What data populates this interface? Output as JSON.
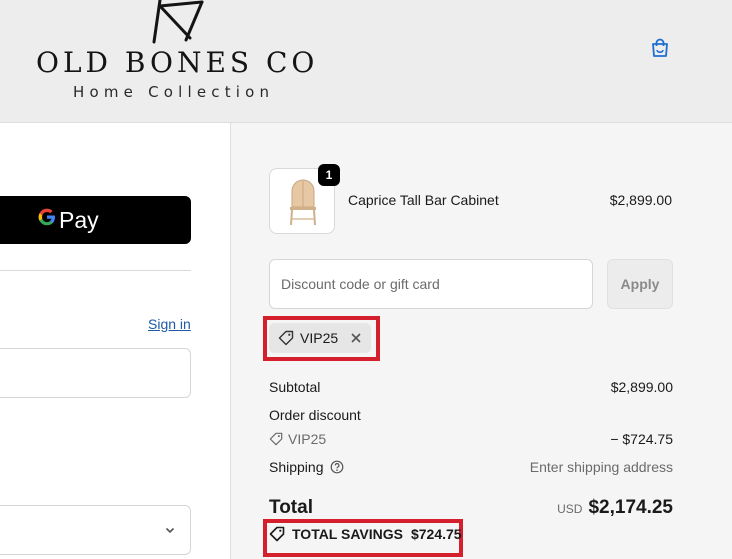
{
  "header": {
    "brand_name": "OLD BONES CO",
    "brand_sub": "Home Collection",
    "bag_icon": "shopping-bag-icon"
  },
  "left": {
    "gpay_label": "Pay",
    "gpay_glyph": "G",
    "signin_label": "Sign in",
    "email_value": "",
    "select_value": ""
  },
  "order": {
    "item": {
      "name": "Caprice Tall Bar Cabinet",
      "price": "$2,899.00",
      "quantity": "1"
    },
    "discount": {
      "placeholder": "Discount code or gift card",
      "apply_label": "Apply"
    },
    "applied_code": "VIP25",
    "subtotal_label": "Subtotal",
    "subtotal_value": "$2,899.00",
    "order_discount_label": "Order discount",
    "discount_code": "VIP25",
    "discount_value": "− $724.75",
    "shipping_label": "Shipping",
    "shipping_value": "Enter shipping address",
    "total_label": "Total",
    "currency": "USD",
    "total_value": "$2,174.25",
    "savings_label": "TOTAL SAVINGS",
    "savings_value": "$724.75"
  },
  "colors": {
    "highlight": "#d4202c",
    "link": "#1f5aa6",
    "bag_icon": "#1f6fd1"
  }
}
